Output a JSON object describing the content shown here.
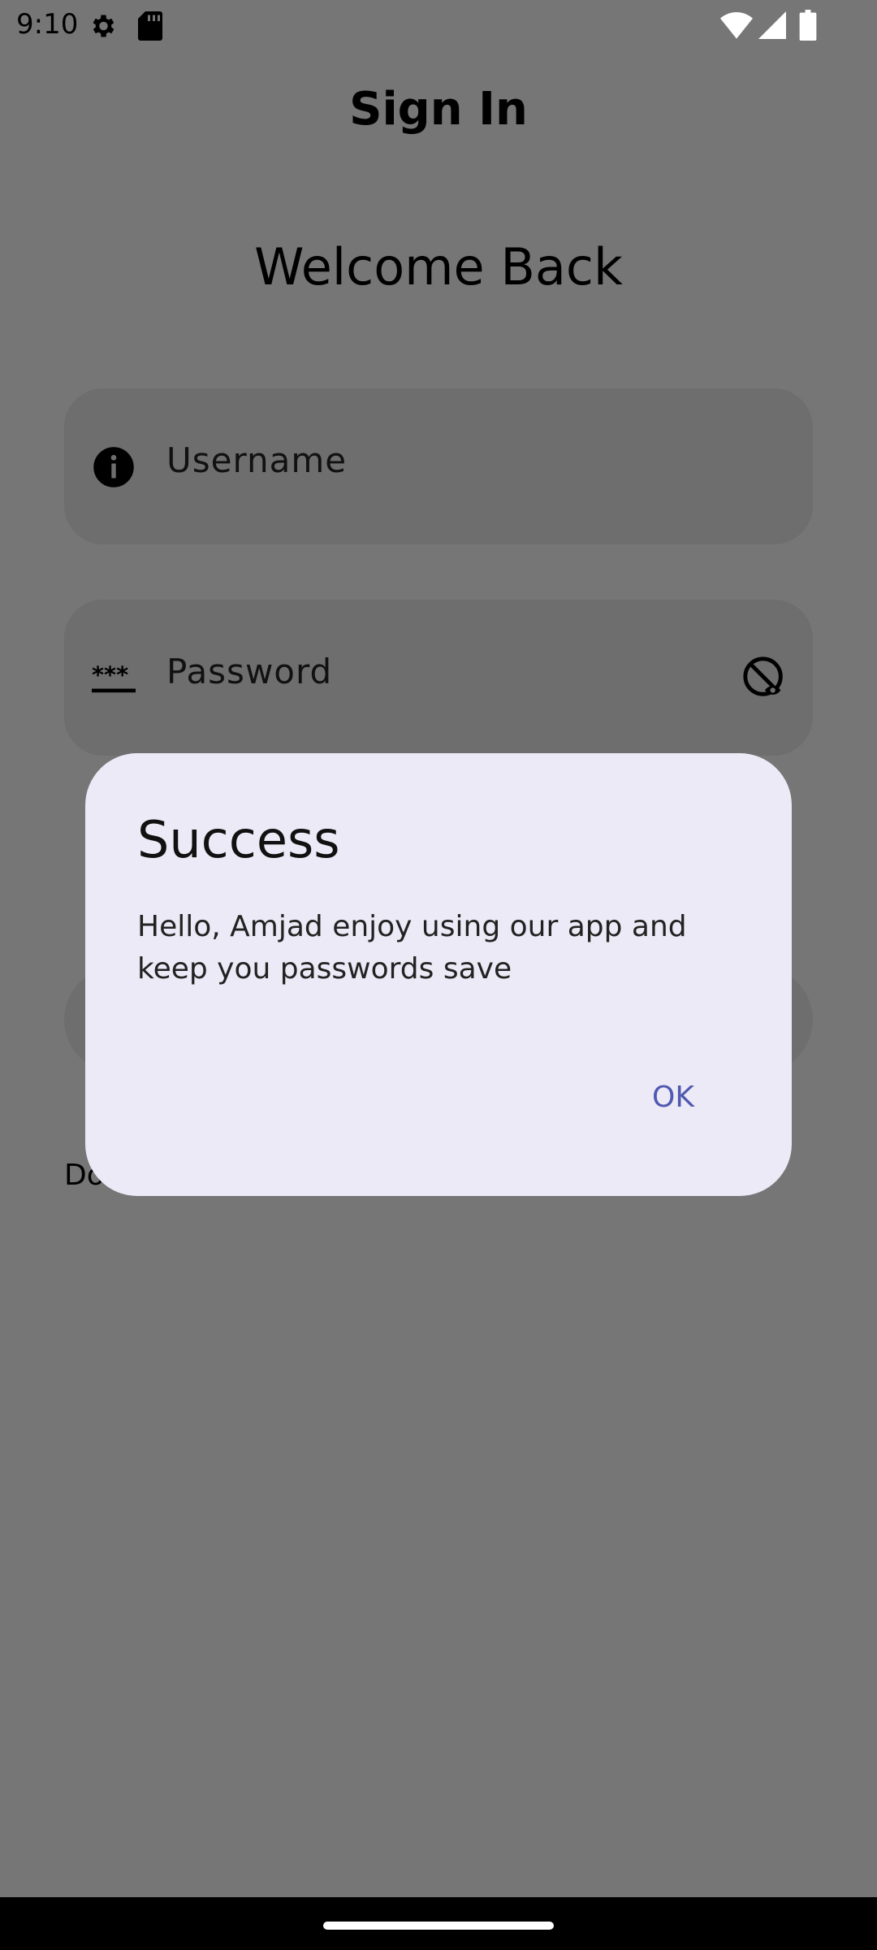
{
  "status_bar": {
    "time": "9:10",
    "icons": [
      "gear-icon",
      "sd-card-icon",
      "wifi-icon",
      "signal-icon",
      "battery-icon"
    ]
  },
  "header": {
    "title": "Sign In"
  },
  "form": {
    "welcome": "Welcome Back",
    "username": {
      "placeholder": "Username",
      "icon": "info-icon"
    },
    "password": {
      "placeholder": "Password",
      "icon": "password-dots-icon",
      "toggle_icon": "visibility-off-icon"
    },
    "hidden_text_prefix": "Do"
  },
  "dialog": {
    "title": "Success",
    "message": "Hello, Amjad enjoy using our app and keep you passwords save",
    "ok_label": "OK",
    "accent_color": "#5059b0"
  },
  "colors": {
    "scrim": "#767676",
    "dialog_background": "#eceaf6"
  }
}
